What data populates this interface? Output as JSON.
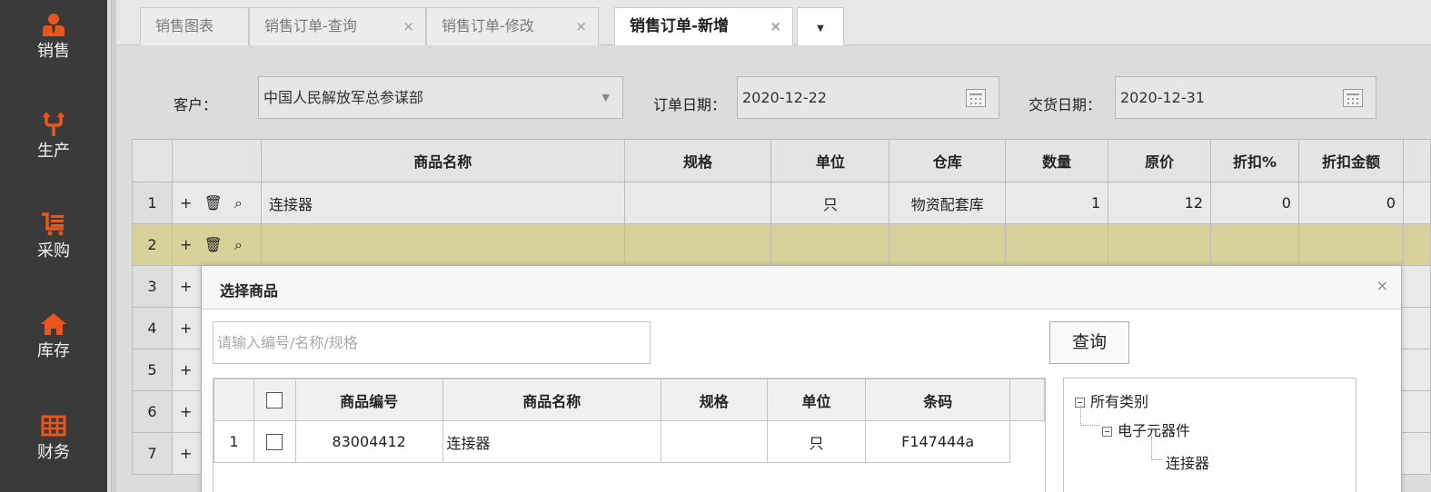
{
  "nav": {
    "items": [
      {
        "label": "销售",
        "icon": "salesperson-icon"
      },
      {
        "label": "生产",
        "icon": "fork-icon"
      },
      {
        "label": "采购",
        "icon": "cart-icon"
      },
      {
        "label": "库存",
        "icon": "home-icon"
      },
      {
        "label": "财务",
        "icon": "grid-icon"
      }
    ],
    "accent": "#e8561d"
  },
  "tabs": [
    {
      "label": "销售图表"
    },
    {
      "label": "销售订单-查询",
      "close": "×"
    },
    {
      "label": "销售订单-修改",
      "close": "×"
    },
    {
      "label": "销售订单-新增",
      "close": "×"
    },
    {
      "label": "▼"
    }
  ],
  "form": {
    "customer_label": "客户：",
    "customer_value": "中国人民解放军总参谋部",
    "order_date_label": "订单日期：",
    "order_date_value": "2020-12-22",
    "delivery_date_label": "交货日期：",
    "delivery_date_value": "2020-12-31"
  },
  "grid": {
    "columns": [
      "",
      "",
      "商品名称",
      "规格",
      "单位",
      "仓库",
      "数量",
      "原价",
      "折扣%",
      "折扣金额"
    ],
    "ops": "+ 🗑 ⌕",
    "rows": [
      {
        "no": "1",
        "name": "连接器",
        "spec": "",
        "unit": "只",
        "warehouse": "物资配套库",
        "qty": "1",
        "price": "12",
        "discount_pct": "0",
        "discount_amt": "0"
      },
      {
        "no": "2",
        "name": "",
        "spec": "",
        "unit": "",
        "warehouse": "",
        "qty": "",
        "price": "",
        "discount_pct": "",
        "discount_amt": ""
      },
      {
        "no": "3"
      },
      {
        "no": "4"
      },
      {
        "no": "5"
      },
      {
        "no": "6"
      },
      {
        "no": "7"
      }
    ],
    "row_op": "+"
  },
  "modal": {
    "title": "选择商品",
    "close": "×",
    "search_placeholder": "请输入编号/名称/规格",
    "query_label": "查询",
    "columns": [
      "",
      "",
      "商品编号",
      "商品名称",
      "规格",
      "单位",
      "条码",
      ""
    ],
    "rows": [
      {
        "no": "1",
        "code": "83004412",
        "name": "连接器",
        "spec": "",
        "unit": "只",
        "barcode": "F147444a"
      }
    ],
    "tree": {
      "root": "所有类别",
      "child": "电子元器件",
      "leaf": "连接器"
    }
  }
}
